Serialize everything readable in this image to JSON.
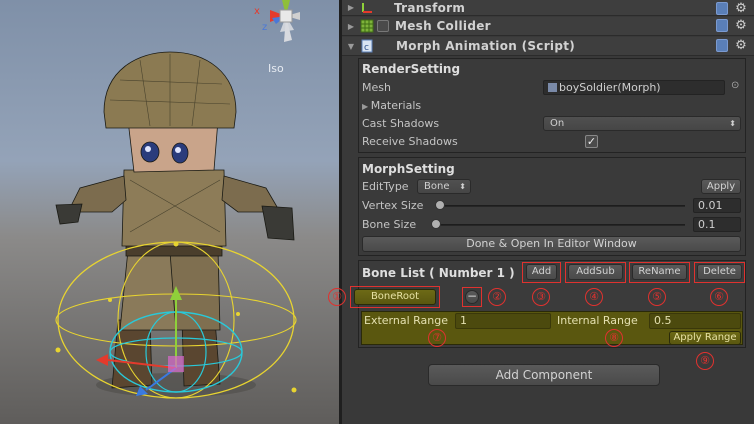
{
  "scene": {
    "view_mode": "Iso",
    "gizmo": {
      "axis_x": "x",
      "axis_z": "z"
    }
  },
  "components": {
    "transform": {
      "title": "Transform"
    },
    "mesh_collider": {
      "title": "Mesh Collider"
    },
    "morph_animation": {
      "title": "Morph Animation (Script)"
    }
  },
  "render_setting": {
    "title": "RenderSetting",
    "mesh_label": "Mesh",
    "mesh_value": "boySoldier(Morph)",
    "materials_label": "Materials",
    "cast_shadows_label": "Cast Shadows",
    "cast_shadows_value": "On",
    "receive_shadows_label": "Receive Shadows",
    "receive_shadows_checked": true
  },
  "morph_setting": {
    "title": "MorphSetting",
    "edit_type_label": "EditType",
    "edit_type_value": "Bone",
    "apply_label": "Apply",
    "vertex_size_label": "Vertex Size",
    "vertex_size_value": "0.01",
    "vertex_size_fraction": 0.0,
    "bone_size_label": "Bone Size",
    "bone_size_value": "0.1",
    "bone_size_fraction": 0.0,
    "done_button_label": "Done & Open In Editor Window"
  },
  "bone_list": {
    "title": "Bone List ( Number 1 )",
    "add_label": "Add",
    "add_sub_label": "AddSub",
    "rename_label": "ReName",
    "delete_label": "Delete",
    "bone_root_label": "BoneRoot",
    "minus_label": "−",
    "external_range_label": "External Range",
    "external_range_value": "1",
    "internal_range_label": "Internal Range",
    "internal_range_value": "0.5",
    "apply_range_label": "Apply Range"
  },
  "callouts": [
    "①",
    "②",
    "③",
    "④",
    "⑤",
    "⑥",
    "⑦",
    "⑧",
    "⑨"
  ],
  "add_component_label": "Add Component",
  "colors": {
    "highlight": "#e0322f",
    "olive": "#5a5710",
    "panel": "#393939"
  }
}
